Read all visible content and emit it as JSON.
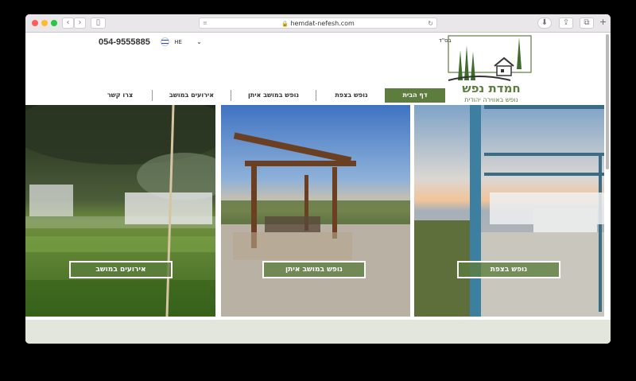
{
  "browser": {
    "url": "hemdat-nefesh.com"
  },
  "header": {
    "phone": "054-9555885",
    "language": "HE",
    "bsd": "בס\"ד",
    "logo": {
      "title": "חמדת נפש",
      "tagline": "נופש באווירה יהודית"
    }
  },
  "menu": {
    "items": [
      {
        "label": "דף הבית",
        "active": true
      },
      {
        "label": "נופש בצפת",
        "active": false
      },
      {
        "label": "נופש במושב איתן",
        "active": false
      },
      {
        "label": "אירועים במושב",
        "active": false
      },
      {
        "label": "צרו קשר",
        "active": false
      }
    ]
  },
  "tiles": [
    {
      "label": "אירועים במושב"
    },
    {
      "label": "נופש במושב איתן"
    },
    {
      "label": "נופש בצפת"
    }
  ],
  "colors": {
    "accent": "#5c7d3e",
    "footer": "#e2e6dc"
  }
}
